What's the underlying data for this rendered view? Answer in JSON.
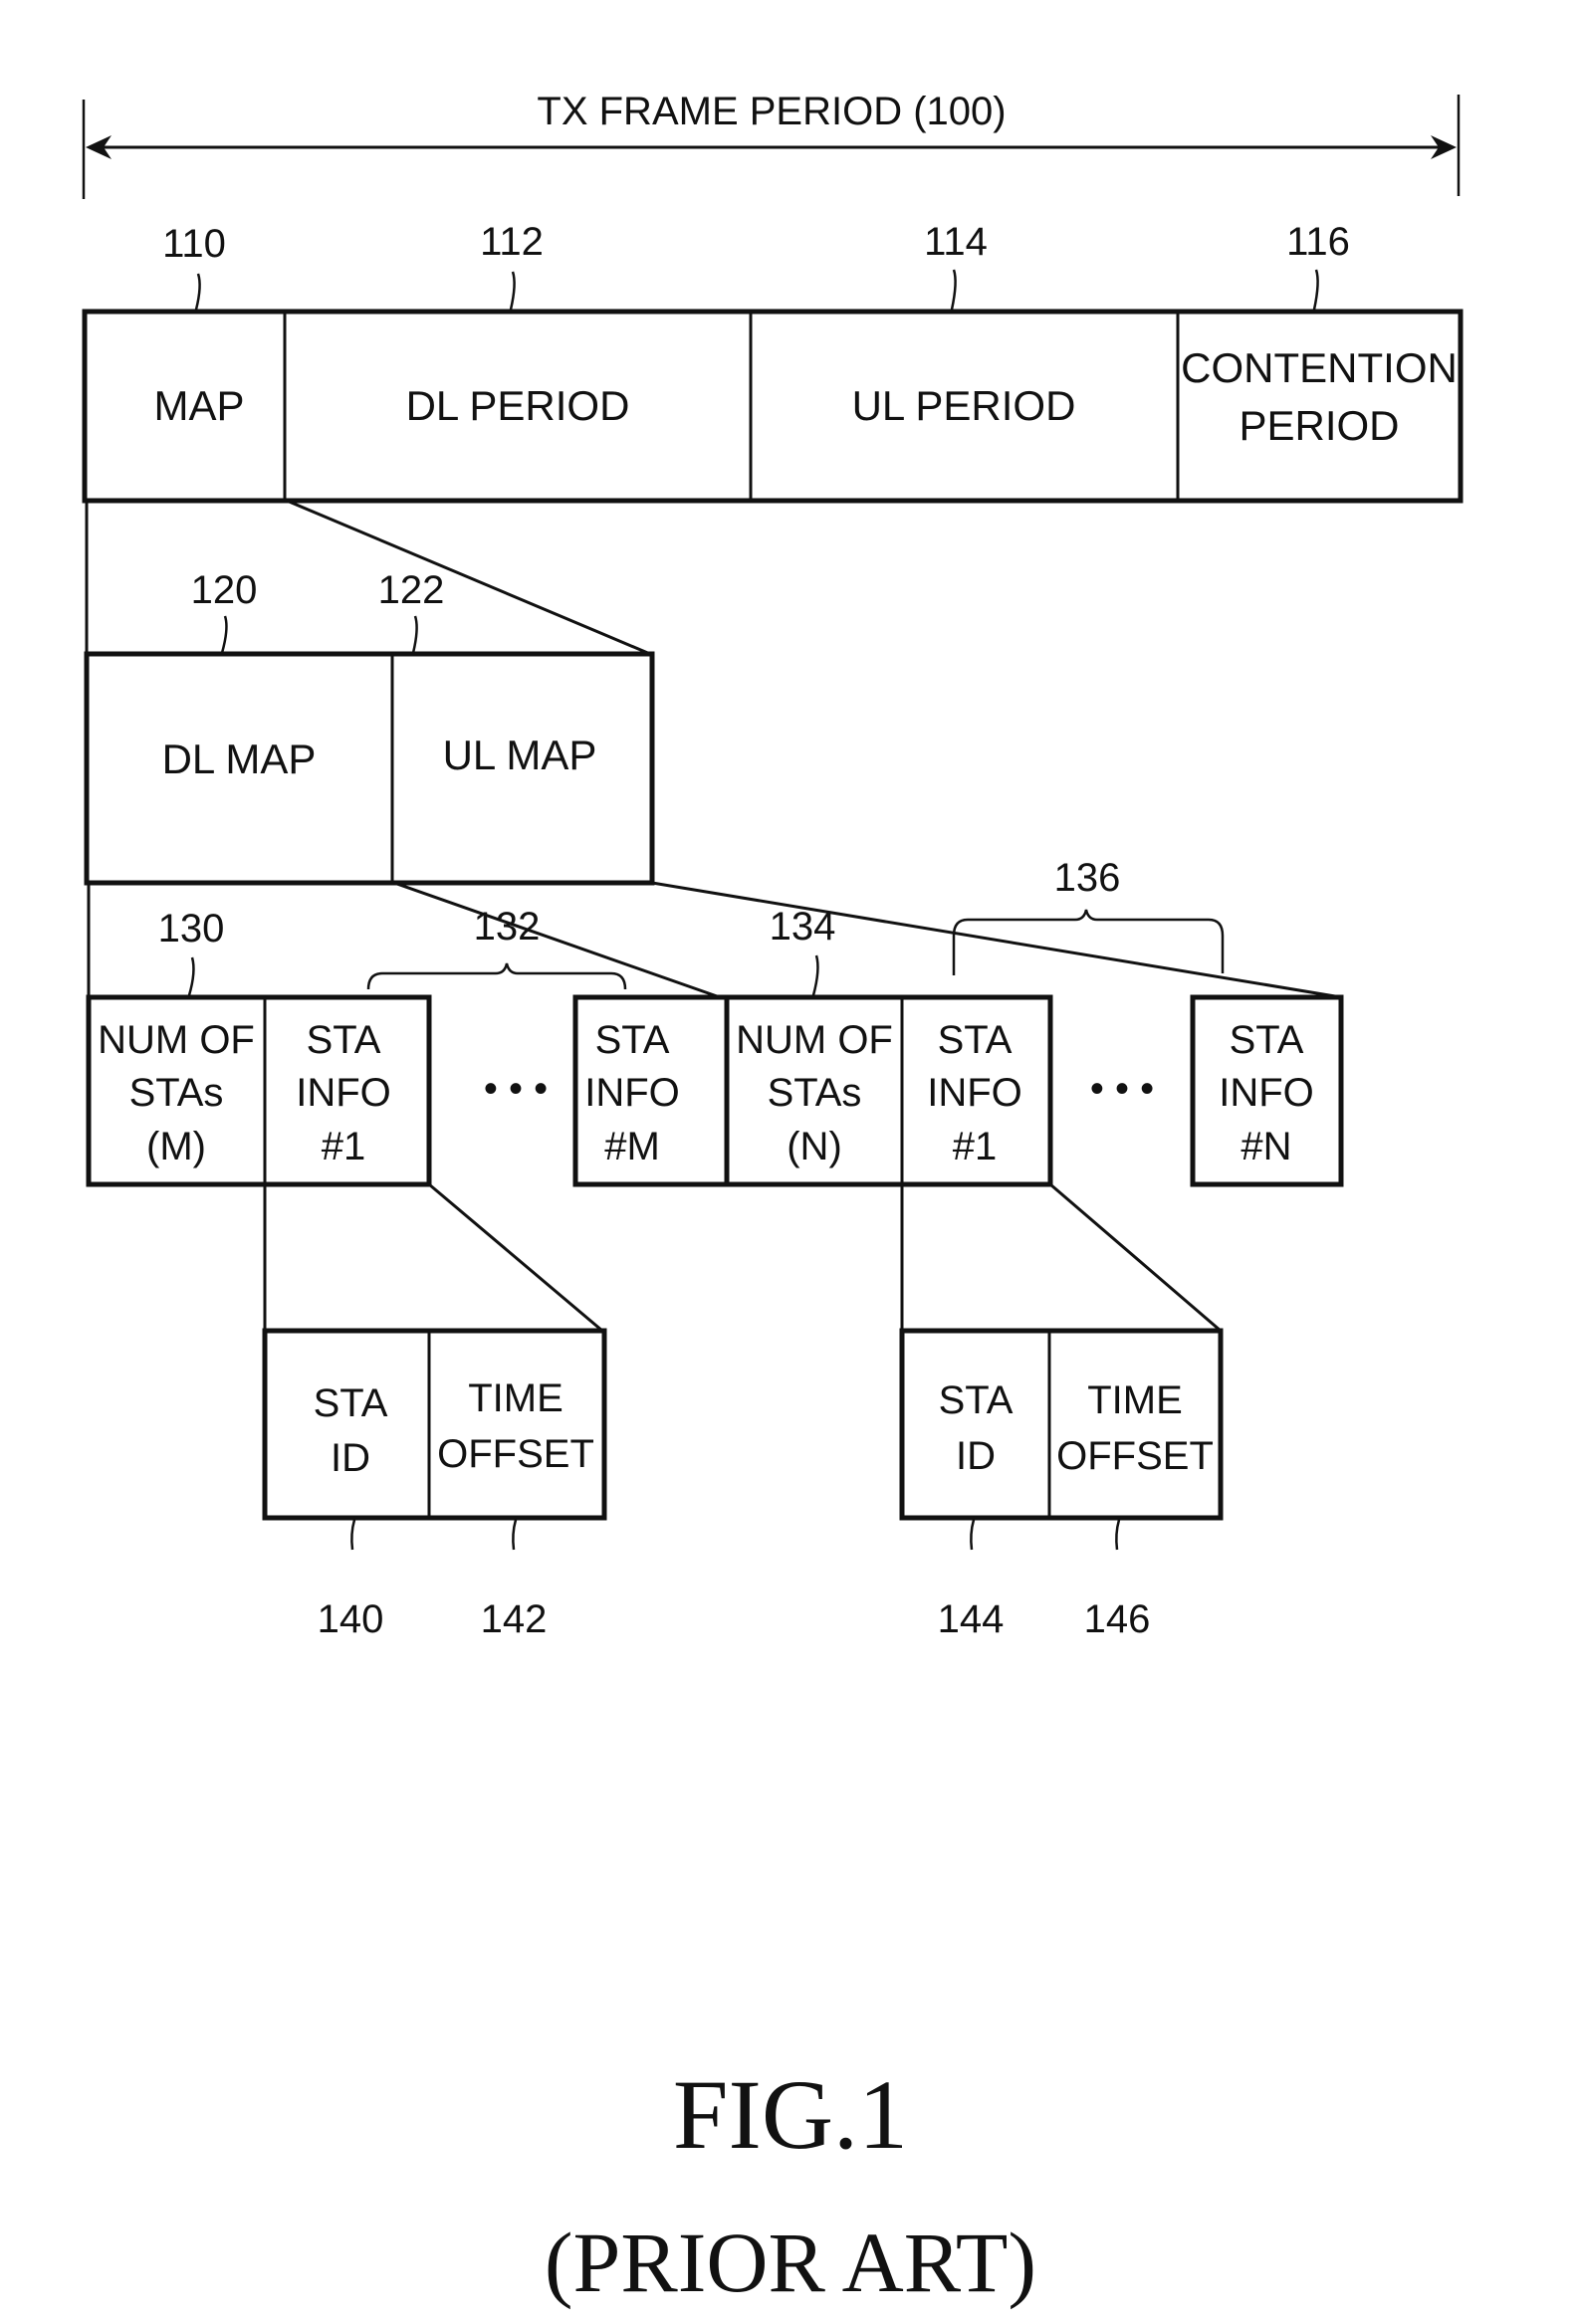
{
  "figure": {
    "title": "FIG.1",
    "subtitle": "(PRIOR ART)"
  },
  "frame": {
    "label": "TX FRAME PERIOD (100)",
    "fields": [
      {
        "ref": "110",
        "lines": [
          "MAP"
        ]
      },
      {
        "ref": "112",
        "lines": [
          "DL PERIOD"
        ]
      },
      {
        "ref": "114",
        "lines": [
          "UL PERIOD"
        ]
      },
      {
        "ref": "116",
        "lines": [
          "CONTENTION",
          "PERIOD"
        ]
      }
    ]
  },
  "map": {
    "fields": [
      {
        "ref": "120",
        "lines": [
          "DL MAP"
        ]
      },
      {
        "ref": "122",
        "lines": [
          "UL MAP"
        ]
      }
    ]
  },
  "dl_map": {
    "ref_num": "130",
    "ref_group": "132",
    "fields": [
      {
        "lines": [
          "NUM OF",
          "STAs",
          "(M)"
        ]
      },
      {
        "lines": [
          "STA",
          "INFO",
          "#1"
        ]
      },
      {
        "lines": [
          "STA",
          "INFO",
          "#M"
        ]
      }
    ],
    "ellipsis": "• • •"
  },
  "ul_map": {
    "ref_num": "134",
    "ref_group": "136",
    "fields": [
      {
        "lines": [
          "NUM OF",
          "STAs",
          "(N)"
        ]
      },
      {
        "lines": [
          "STA",
          "INFO",
          "#1"
        ]
      },
      {
        "lines": [
          "STA",
          "INFO",
          "#N"
        ]
      }
    ],
    "ellipsis": "• • •"
  },
  "dl_sta_info": {
    "fields": [
      {
        "ref": "140",
        "lines": [
          "STA",
          "ID"
        ]
      },
      {
        "ref": "142",
        "lines": [
          "TIME",
          "OFFSET"
        ]
      }
    ]
  },
  "ul_sta_info": {
    "fields": [
      {
        "ref": "144",
        "lines": [
          "STA",
          "ID"
        ]
      },
      {
        "ref": "146",
        "lines": [
          "TIME",
          "OFFSET"
        ]
      }
    ]
  }
}
